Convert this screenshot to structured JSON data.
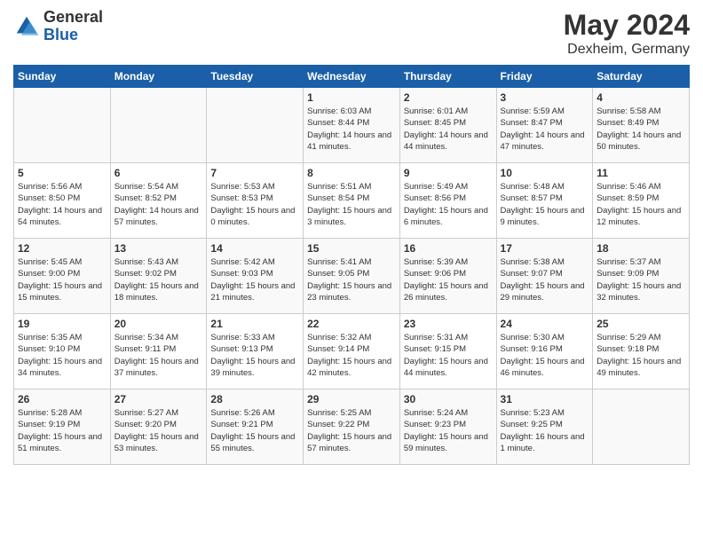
{
  "header": {
    "logo_general": "General",
    "logo_blue": "Blue",
    "title": "May 2024",
    "subtitle": "Dexheim, Germany"
  },
  "days_of_week": [
    "Sunday",
    "Monday",
    "Tuesday",
    "Wednesday",
    "Thursday",
    "Friday",
    "Saturday"
  ],
  "weeks": [
    [
      {
        "day": "",
        "info": ""
      },
      {
        "day": "",
        "info": ""
      },
      {
        "day": "",
        "info": ""
      },
      {
        "day": "1",
        "info": "Sunrise: 6:03 AM\nSunset: 8:44 PM\nDaylight: 14 hours\nand 41 minutes."
      },
      {
        "day": "2",
        "info": "Sunrise: 6:01 AM\nSunset: 8:45 PM\nDaylight: 14 hours\nand 44 minutes."
      },
      {
        "day": "3",
        "info": "Sunrise: 5:59 AM\nSunset: 8:47 PM\nDaylight: 14 hours\nand 47 minutes."
      },
      {
        "day": "4",
        "info": "Sunrise: 5:58 AM\nSunset: 8:49 PM\nDaylight: 14 hours\nand 50 minutes."
      }
    ],
    [
      {
        "day": "5",
        "info": "Sunrise: 5:56 AM\nSunset: 8:50 PM\nDaylight: 14 hours\nand 54 minutes."
      },
      {
        "day": "6",
        "info": "Sunrise: 5:54 AM\nSunset: 8:52 PM\nDaylight: 14 hours\nand 57 minutes."
      },
      {
        "day": "7",
        "info": "Sunrise: 5:53 AM\nSunset: 8:53 PM\nDaylight: 15 hours\nand 0 minutes."
      },
      {
        "day": "8",
        "info": "Sunrise: 5:51 AM\nSunset: 8:54 PM\nDaylight: 15 hours\nand 3 minutes."
      },
      {
        "day": "9",
        "info": "Sunrise: 5:49 AM\nSunset: 8:56 PM\nDaylight: 15 hours\nand 6 minutes."
      },
      {
        "day": "10",
        "info": "Sunrise: 5:48 AM\nSunset: 8:57 PM\nDaylight: 15 hours\nand 9 minutes."
      },
      {
        "day": "11",
        "info": "Sunrise: 5:46 AM\nSunset: 8:59 PM\nDaylight: 15 hours\nand 12 minutes."
      }
    ],
    [
      {
        "day": "12",
        "info": "Sunrise: 5:45 AM\nSunset: 9:00 PM\nDaylight: 15 hours\nand 15 minutes."
      },
      {
        "day": "13",
        "info": "Sunrise: 5:43 AM\nSunset: 9:02 PM\nDaylight: 15 hours\nand 18 minutes."
      },
      {
        "day": "14",
        "info": "Sunrise: 5:42 AM\nSunset: 9:03 PM\nDaylight: 15 hours\nand 21 minutes."
      },
      {
        "day": "15",
        "info": "Sunrise: 5:41 AM\nSunset: 9:05 PM\nDaylight: 15 hours\nand 23 minutes."
      },
      {
        "day": "16",
        "info": "Sunrise: 5:39 AM\nSunset: 9:06 PM\nDaylight: 15 hours\nand 26 minutes."
      },
      {
        "day": "17",
        "info": "Sunrise: 5:38 AM\nSunset: 9:07 PM\nDaylight: 15 hours\nand 29 minutes."
      },
      {
        "day": "18",
        "info": "Sunrise: 5:37 AM\nSunset: 9:09 PM\nDaylight: 15 hours\nand 32 minutes."
      }
    ],
    [
      {
        "day": "19",
        "info": "Sunrise: 5:35 AM\nSunset: 9:10 PM\nDaylight: 15 hours\nand 34 minutes."
      },
      {
        "day": "20",
        "info": "Sunrise: 5:34 AM\nSunset: 9:11 PM\nDaylight: 15 hours\nand 37 minutes."
      },
      {
        "day": "21",
        "info": "Sunrise: 5:33 AM\nSunset: 9:13 PM\nDaylight: 15 hours\nand 39 minutes."
      },
      {
        "day": "22",
        "info": "Sunrise: 5:32 AM\nSunset: 9:14 PM\nDaylight: 15 hours\nand 42 minutes."
      },
      {
        "day": "23",
        "info": "Sunrise: 5:31 AM\nSunset: 9:15 PM\nDaylight: 15 hours\nand 44 minutes."
      },
      {
        "day": "24",
        "info": "Sunrise: 5:30 AM\nSunset: 9:16 PM\nDaylight: 15 hours\nand 46 minutes."
      },
      {
        "day": "25",
        "info": "Sunrise: 5:29 AM\nSunset: 9:18 PM\nDaylight: 15 hours\nand 49 minutes."
      }
    ],
    [
      {
        "day": "26",
        "info": "Sunrise: 5:28 AM\nSunset: 9:19 PM\nDaylight: 15 hours\nand 51 minutes."
      },
      {
        "day": "27",
        "info": "Sunrise: 5:27 AM\nSunset: 9:20 PM\nDaylight: 15 hours\nand 53 minutes."
      },
      {
        "day": "28",
        "info": "Sunrise: 5:26 AM\nSunset: 9:21 PM\nDaylight: 15 hours\nand 55 minutes."
      },
      {
        "day": "29",
        "info": "Sunrise: 5:25 AM\nSunset: 9:22 PM\nDaylight: 15 hours\nand 57 minutes."
      },
      {
        "day": "30",
        "info": "Sunrise: 5:24 AM\nSunset: 9:23 PM\nDaylight: 15 hours\nand 59 minutes."
      },
      {
        "day": "31",
        "info": "Sunrise: 5:23 AM\nSunset: 9:25 PM\nDaylight: 16 hours\nand 1 minute."
      },
      {
        "day": "",
        "info": ""
      }
    ]
  ]
}
